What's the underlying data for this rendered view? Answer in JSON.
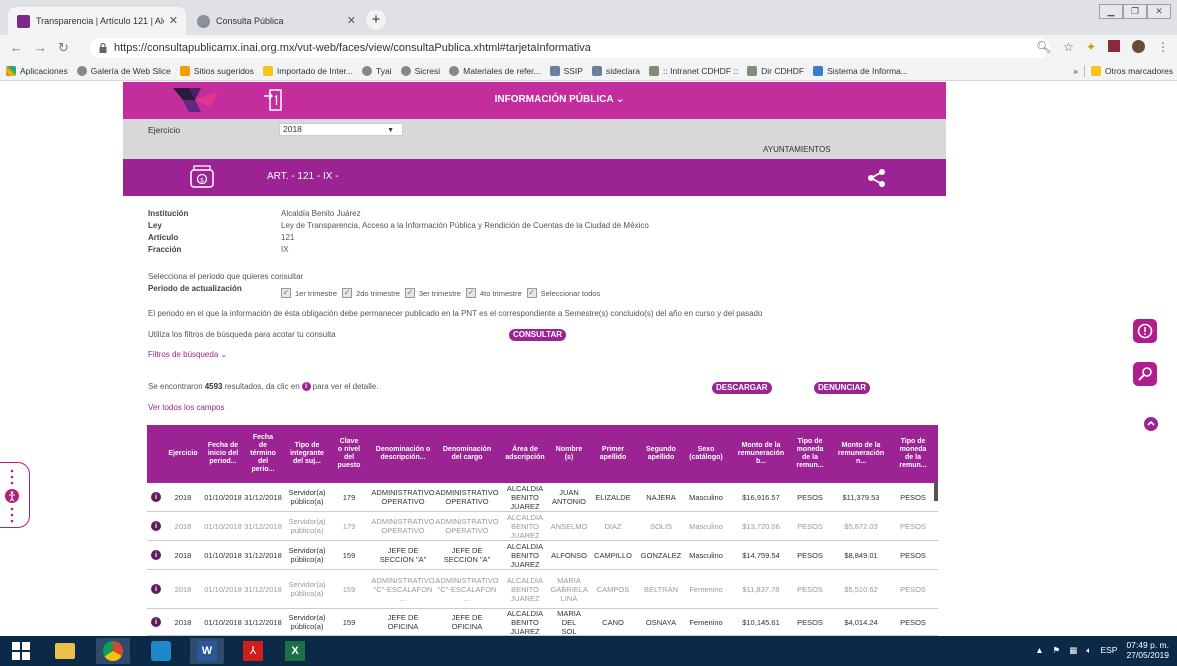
{
  "browser": {
    "tabs": [
      {
        "label": "Transparencia | Artículo 121 | Alc",
        "active": true
      },
      {
        "label": "Consulta Pública",
        "active": false
      }
    ],
    "url": "https://consultapublicamx.inai.org.mx/vut-web/faces/view/consultaPublica.xhtml#tarjetaInformativa",
    "bookmarks": [
      "Aplicaciones",
      "Galería de Web Slice",
      "Sitios sugeridos",
      "Importado de Inter...",
      "Tyai",
      "Sicresi",
      "Materiales de refer...",
      "SSIP",
      "sideclara",
      ":: Intranet CDHDF ::",
      "Dir CDHDF",
      "Sistema de Informa..."
    ],
    "bookmarks_overflow": "»",
    "other_bookmarks": "Otros marcadores"
  },
  "header": {
    "title": "INFORMACIÓN PÚBLICA",
    "ejercicio_label": "Ejercicio",
    "ejercicio_value": "2018",
    "sujeto_tipo": "AYUNTAMIENTOS",
    "articulo_title": "ART. - 121 - IX -"
  },
  "info": {
    "institucion_label": "Institución",
    "institucion": "Alcaldía Benito Juárez",
    "ley_label": "Ley",
    "ley": "Ley de Transparencia, Acceso a la Información Pública y Rendición de Cuentas de la Ciudad de México",
    "articulo_label": "Artículo",
    "articulo": "121",
    "fraccion_label": "Fracción",
    "fraccion": "IX"
  },
  "periodo": {
    "hint": "Selecciona el periodo que quieres consultar",
    "label": "Periodo de actualización",
    "options": [
      "1er trimestre",
      "2do trimestre",
      "3er trimestre",
      "4to trimestre",
      "Seleccionar todos"
    ],
    "note": "El periodo en el que la información de ésta obligación debe permanecer publicado en la PNT es el correspondiente a Semestre(s) concluido(s) del año en curso y del pasado"
  },
  "filters": {
    "hint": "Utiliza los filtros de búsqueda para acotar tu consulta",
    "consultar": "CONSULTAR",
    "link": "Filtros de búsqueda"
  },
  "results": {
    "prefix": "Se encontraron",
    "count": "4593",
    "middle": "resultados, da clic en",
    "suffix": "para ver el detalle.",
    "descargar": "DESCARGAR",
    "denunciar": "DENUNCIAR",
    "ver_todos": "Ver todos los campos"
  },
  "table": {
    "headers": [
      "Ejercicio",
      "Fecha de inicio del period...",
      "Fecha de término del perio...",
      "Tipo de integrante del suj...",
      "Clave o nivel del puesto",
      "Denominación o descripción...",
      "Denominación del cargo",
      "Área de adscripción",
      "Nombre (s)",
      "Primer apellido",
      "Segundo apellido",
      "Sexo (catálogo)",
      "Monto de la remuneración b...",
      "Tipo de moneda de la remun...",
      "Monto de la remuneración n...",
      "Tipo de moneda de la remun..."
    ],
    "rows": [
      [
        "2018",
        "01/10/2018",
        "31/12/2018",
        "Servidor(a) público(a)",
        "179",
        "ADMINISTRATIVO OPERATIVO",
        "ADMINISTRATIVO OPERATIVO",
        "ALCALDIA BENITO JUAREZ",
        "JUAN ANTONIO",
        "ELIZALDE",
        "NAJERA",
        "Masculino",
        "$16,916.57",
        "PESOS",
        "$11,379.53",
        "PESOS"
      ],
      [
        "2018",
        "01/10/2018",
        "31/12/2018",
        "Servidor(a) público(a)",
        "179",
        "ADMINISTRATIVO OPERATIVO",
        "ADMINISTRATIVO OPERATIVO",
        "ALCALDIA BENITO JUAREZ",
        "ANSELMO",
        "DIAZ",
        "SOLIS",
        "Masculino",
        "$13,720.06",
        "PESOS",
        "$5,872.03",
        "PESOS"
      ],
      [
        "2018",
        "01/10/2018",
        "31/12/2018",
        "Servidor(a) público(a)",
        "159",
        "JEFE DE SECCION \"A\"",
        "JEFE DE SECCION \"A\"",
        "ALCALDIA BENITO JUAREZ",
        "ALFONSO",
        "CAMPILLO",
        "GONZALEZ",
        "Masculino",
        "$14,759.54",
        "PESOS",
        "$8,849.01",
        "PESOS"
      ],
      [
        "2018",
        "01/10/2018",
        "31/12/2018",
        "Servidor(a) público(a)",
        "159",
        "ADMINISTRATIVO \"C\"-ESCALAFON ...",
        "ADMINISTRATIVO \"C\"-ESCALAFON ...",
        "ALCALDIA BENITO JUAREZ",
        "MARIA GABRIELA LINA",
        "CAMPOS",
        "BELTRAN",
        "Femenino",
        "$11,837.78",
        "PESOS",
        "$5,510.62",
        "PESOS"
      ],
      [
        "2018",
        "01/10/2018",
        "31/12/2018",
        "Servidor(a) público(a)",
        "159",
        "JEFE DE OFICINA",
        "JEFE DE OFICINA",
        "ALCALDIA BENITO JUAREZ",
        "MARIA DEL SOL",
        "CANO",
        "OSNAYA",
        "Femenino",
        "$10,145.61",
        "PESOS",
        "$4,014.24",
        "PESOS"
      ]
    ],
    "row_dim": [
      false,
      true,
      false,
      true,
      false
    ]
  },
  "taskbar": {
    "lang": "ESP",
    "time": "07:49 p. m.",
    "date": "27/05/2019"
  },
  "colors": {
    "magenta": "#c42d9d",
    "purple": "#9b2394",
    "taskbar": "#0b2a48"
  }
}
